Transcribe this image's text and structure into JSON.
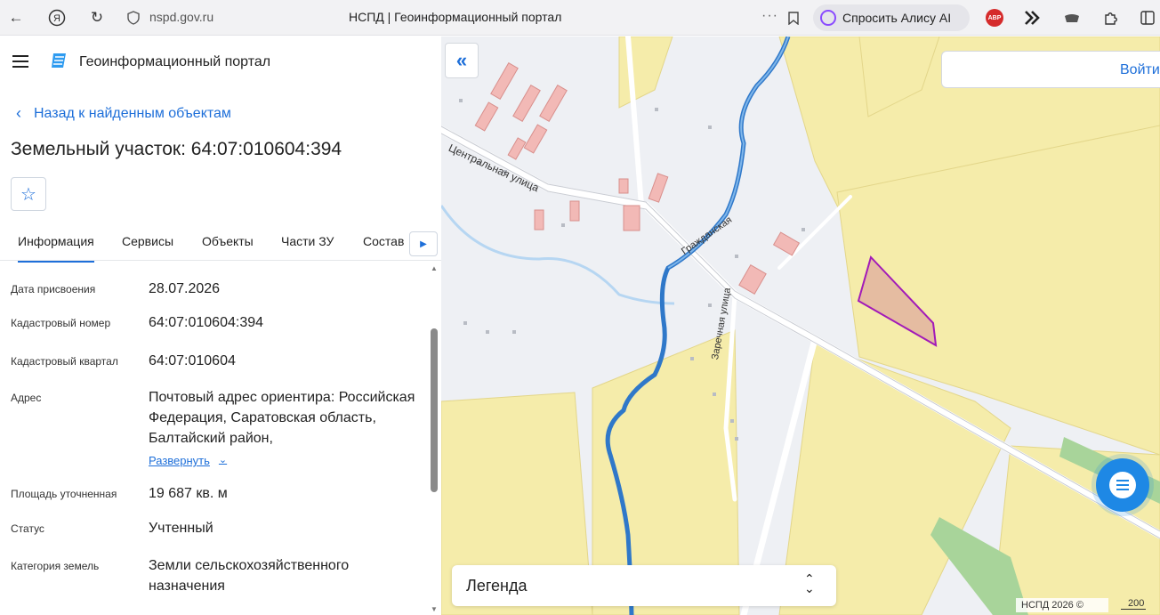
{
  "browser": {
    "url": "nspd.gov.ru",
    "tab_title": "НСПД | Геоинформационный портал",
    "alice_label": "Спросить Алису AI",
    "abp_label": "ABP",
    "icons": [
      "back-arrow-icon",
      "yandex-icon",
      "reload-icon",
      "shield-icon",
      "more-icon",
      "bookmark-icon",
      "alice-icon",
      "adblock-icon",
      "extension-icon",
      "puzzle-icon"
    ]
  },
  "sidebar": {
    "portal_title": "Геоинформационный портал",
    "back_link": "Назад к найденным объектам",
    "page_title": "Земельный участок: 64:07:010604:394",
    "tabs": [
      {
        "label": "Информация",
        "active": true
      },
      {
        "label": "Сервисы"
      },
      {
        "label": "Объекты"
      },
      {
        "label": "Части ЗУ"
      },
      {
        "label": "Состав"
      }
    ],
    "properties": [
      {
        "label": "Дата присвоения",
        "value": "28.07.2026"
      },
      {
        "label": "Кадастровый номер",
        "value": "64:07:010604:394"
      },
      {
        "label": "Кадастровый квартал",
        "value": "64:07:010604"
      },
      {
        "label": "Адрес",
        "value": "Почтовый адрес ориентира: Российская Федерация, Саратовская область, Балтайский район,",
        "expand_label": "Развернуть"
      },
      {
        "label": "Площадь уточненная",
        "value": "19 687 кв. м"
      },
      {
        "label": "Статус",
        "value": "Учтенный"
      },
      {
        "label": "Категория земель",
        "value": "Земли сельскохозяйственного назначения"
      }
    ]
  },
  "map": {
    "login_label": "Войти",
    "legend_label": "Легенда",
    "copyright": "НСПД 2026 ©",
    "scale_label": "200",
    "street_labels": [
      "Центральная улица",
      "Заречная улица",
      "Гражданская"
    ],
    "colors": {
      "parcel_fill": "#f5ecaa",
      "highlight_stroke": "#a21ab8",
      "river": "#2f78c9",
      "building": "#f2b9b6"
    }
  }
}
